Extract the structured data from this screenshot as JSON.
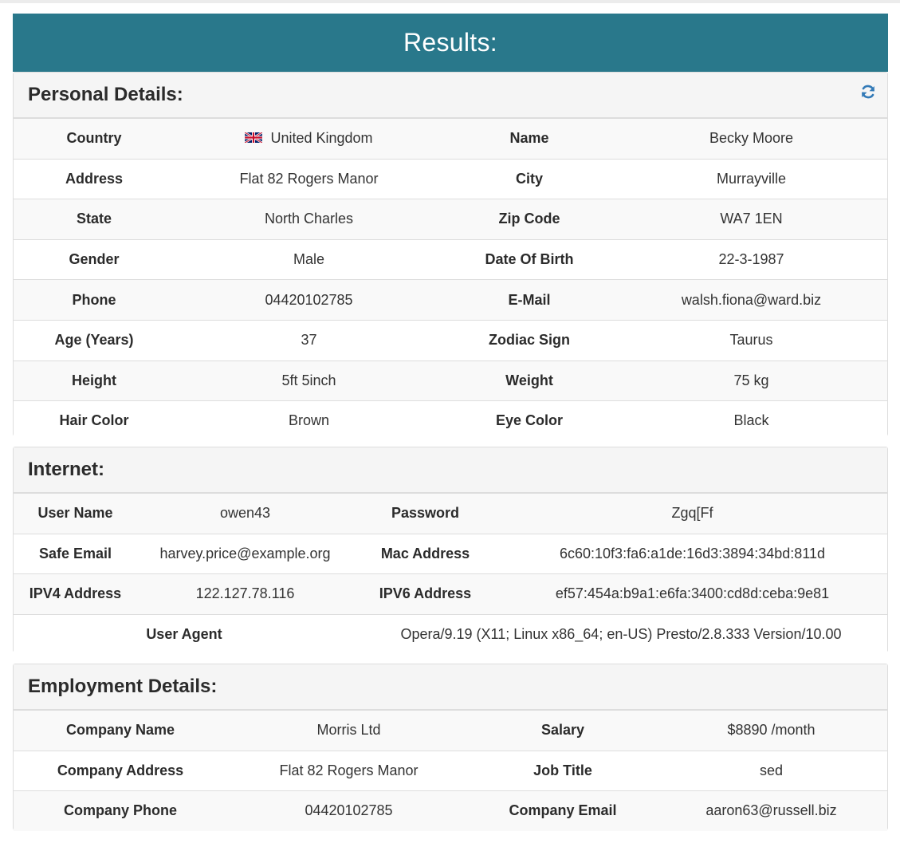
{
  "header": {
    "title": "Results:"
  },
  "personal": {
    "title": "Personal Details:",
    "refresh_icon": "refresh-icon",
    "rows": [
      [
        {
          "label": "Country",
          "value": "United Kingdom",
          "flag": "uk-flag-icon"
        },
        {
          "label": "Name",
          "value": "Becky Moore"
        }
      ],
      [
        {
          "label": "Address",
          "value": "Flat 82 Rogers Manor"
        },
        {
          "label": "City",
          "value": "Murrayville"
        }
      ],
      [
        {
          "label": "State",
          "value": "North Charles"
        },
        {
          "label": "Zip Code",
          "value": "WA7 1EN"
        }
      ],
      [
        {
          "label": "Gender",
          "value": "Male"
        },
        {
          "label": "Date Of Birth",
          "value": "22-3-1987"
        }
      ],
      [
        {
          "label": "Phone",
          "value": "04420102785"
        },
        {
          "label": "E-Mail",
          "value": "walsh.fiona@ward.biz"
        }
      ],
      [
        {
          "label": "Age (Years)",
          "value": "37"
        },
        {
          "label": "Zodiac Sign",
          "value": "Taurus"
        }
      ],
      [
        {
          "label": "Height",
          "value": "5ft 5inch"
        },
        {
          "label": "Weight",
          "value": "75 kg"
        }
      ],
      [
        {
          "label": "Hair Color",
          "value": "Brown"
        },
        {
          "label": "Eye Color",
          "value": "Black"
        }
      ]
    ]
  },
  "internet": {
    "title": "Internet:",
    "rows": [
      [
        {
          "label": "User Name",
          "value": "owen43"
        },
        {
          "label": "Password",
          "value": "Zgq[Ff"
        }
      ],
      [
        {
          "label": "Safe Email",
          "value": "harvey.price@example.org"
        },
        {
          "label": "Mac Address",
          "value": "6c60:10f3:fa6:a1de:16d3:3894:34bd:811d"
        }
      ],
      [
        {
          "label": "IPV4 Address",
          "value": "122.127.78.116"
        },
        {
          "label": "IPV6 Address",
          "value": "ef57:454a:b9a1:e6fa:3400:cd8d:ceba:9e81"
        }
      ]
    ],
    "user_agent": {
      "label": "User Agent",
      "value": "Opera/9.19 (X11; Linux x86_64; en-US) Presto/2.8.333 Version/10.00"
    }
  },
  "employment": {
    "title": "Employment Details:",
    "rows": [
      [
        {
          "label": "Company Name",
          "value": "Morris Ltd"
        },
        {
          "label": "Salary",
          "value": "$8890 /month"
        }
      ],
      [
        {
          "label": "Company Address",
          "value": "Flat 82 Rogers Manor"
        },
        {
          "label": "Job Title",
          "value": "sed"
        }
      ],
      [
        {
          "label": "Company Phone",
          "value": "04420102785"
        },
        {
          "label": "Company Email",
          "value": "aaron63@russell.biz"
        }
      ]
    ]
  },
  "colors": {
    "header_bg": "#29788b",
    "refresh_icon": "#337ab7"
  }
}
